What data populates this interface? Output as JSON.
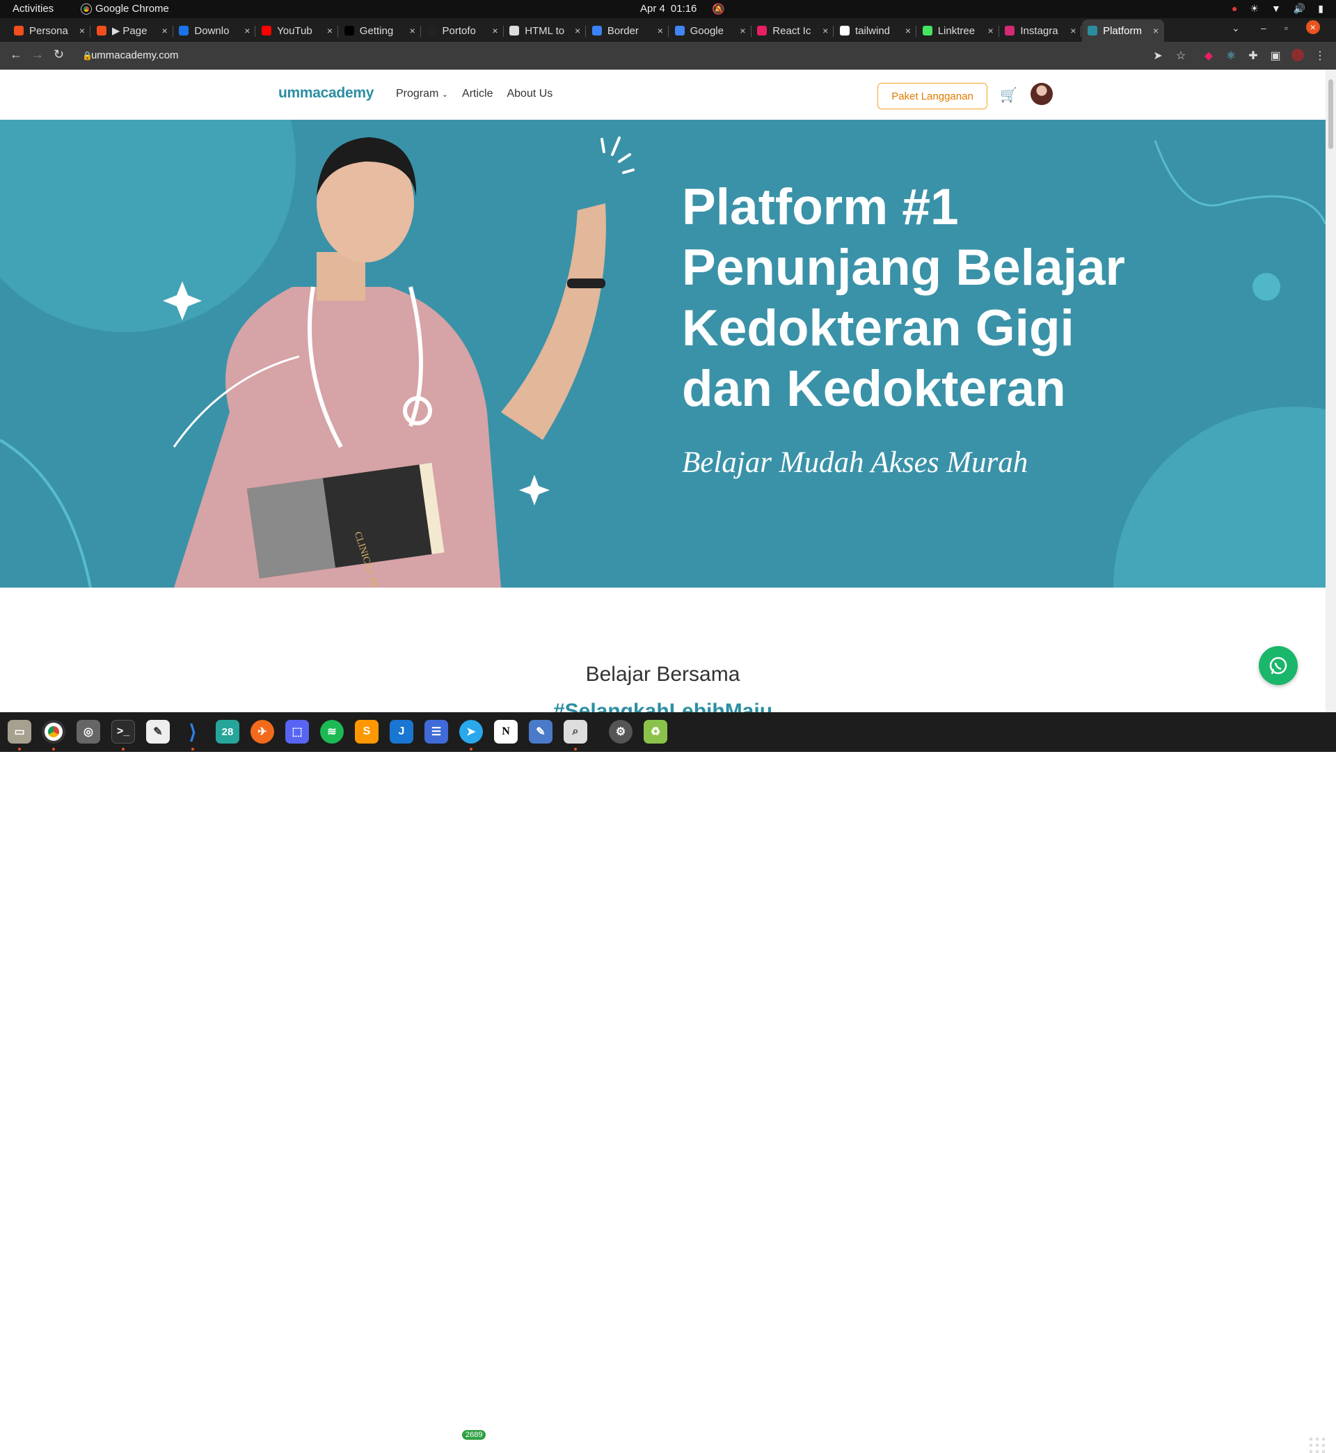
{
  "system": {
    "activities": "Activities",
    "app_name": "Google Chrome",
    "date": "Apr 4",
    "time": "01:16"
  },
  "tabs": [
    {
      "title": "Persona",
      "favicon_color": "#f24e1e"
    },
    {
      "title": "▶ Page",
      "favicon_color": "#f24e1e"
    },
    {
      "title": "Downlo",
      "favicon_color": "#1a73e8"
    },
    {
      "title": "YouTub",
      "favicon_color": "#ff0000"
    },
    {
      "title": "Getting",
      "favicon_color": "#000000"
    },
    {
      "title": "Portofo",
      "favicon_color": "#222222"
    },
    {
      "title": "HTML to",
      "favicon_color": "#dddddd"
    },
    {
      "title": "Border",
      "favicon_color": "#3b82f6"
    },
    {
      "title": "Google",
      "favicon_color": "#4285f4"
    },
    {
      "title": "React Ic",
      "favicon_color": "#e91e63"
    },
    {
      "title": "tailwind",
      "favicon_color": "#ffffff"
    },
    {
      "title": "Linktree",
      "favicon_color": "#43e660"
    },
    {
      "title": "Instagra",
      "favicon_color": "#d62976"
    },
    {
      "title": "Platform",
      "favicon_color": "#2b8ea0",
      "active": true
    }
  ],
  "address": {
    "url": "ummacademy.com"
  },
  "site": {
    "logo": "ummacademy",
    "menu": [
      "Program",
      "Article",
      "About Us"
    ],
    "paket_button": "Paket Langganan",
    "hero_title_lines": [
      "Platform #1",
      "Penunjang Belajar",
      "Kedokteran Gigi",
      "dan Kedokteran"
    ],
    "hero_tagline": "Belajar Mudah Akses Murah",
    "section_title": "Belajar Bersama",
    "section_hashtag": "#SelangkahLebihMaju",
    "book_text": "CLINICAL PERIODONTO"
  },
  "dock": {
    "telegram_badge": "2689",
    "calendar_day": "28"
  },
  "colors": {
    "hero_bg": "#3a92a8",
    "brand": "#2b8ea0",
    "cta_border": "#f5a623",
    "whatsapp": "#1ab66a"
  }
}
